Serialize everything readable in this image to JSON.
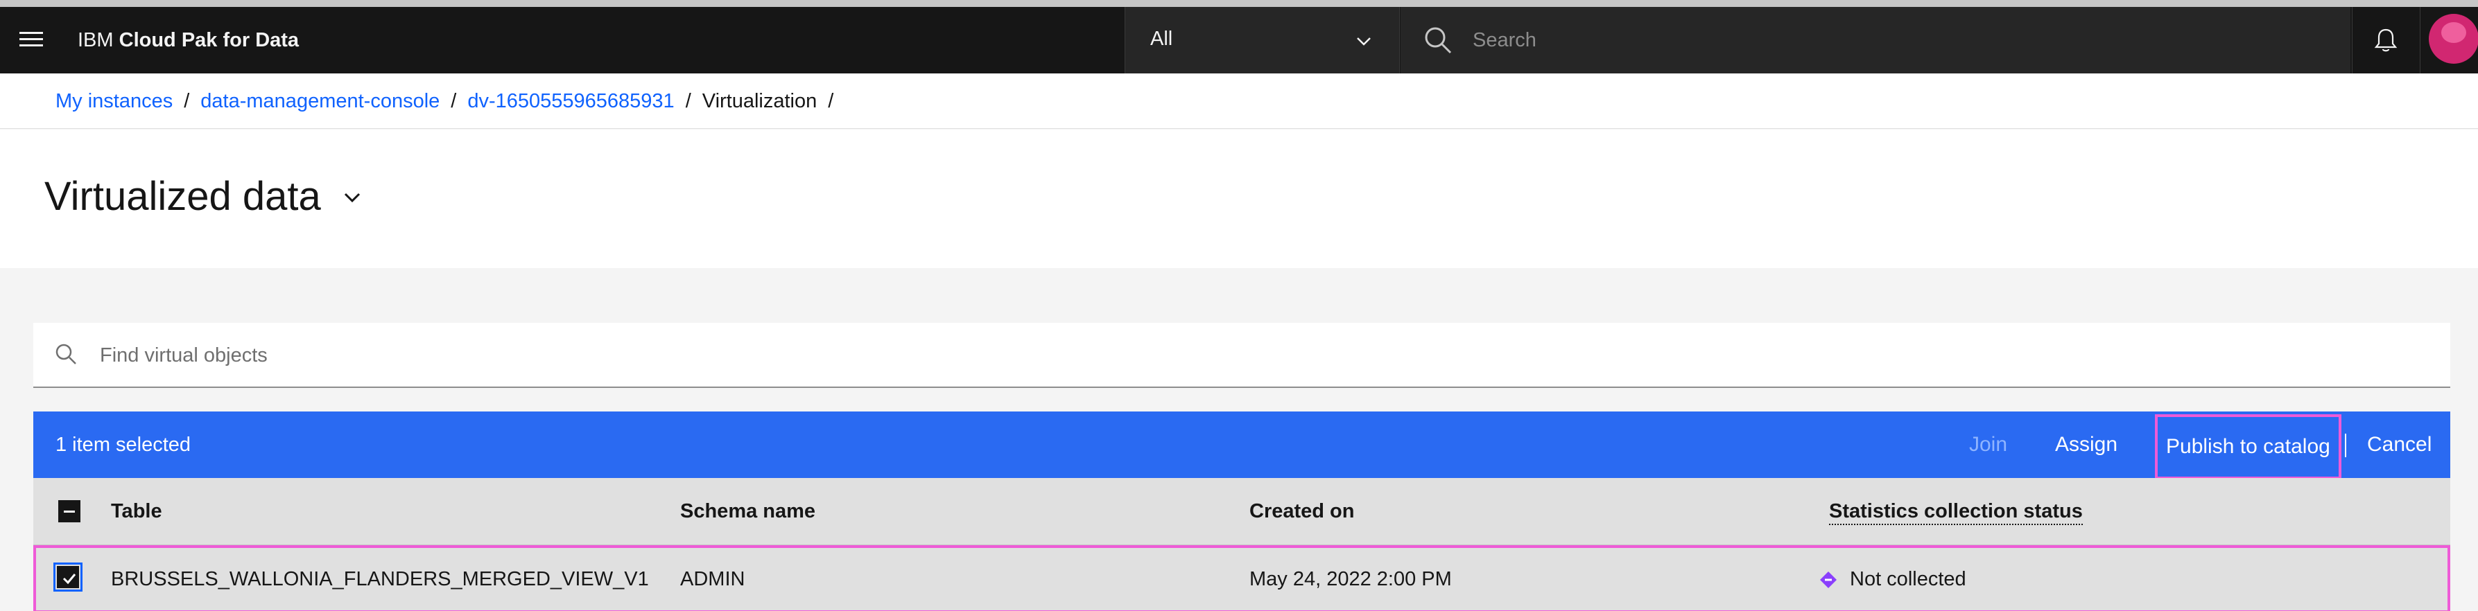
{
  "header": {
    "menu_icon": "hamburger-menu-icon",
    "brand_ibm": "IBM",
    "brand_product": "Cloud Pak for Data",
    "scope_value": "All",
    "search_placeholder": "Search",
    "notification_icon": "bell-icon",
    "avatar_icon": "user-avatar-icon"
  },
  "breadcrumb": {
    "items": [
      {
        "label": "My instances",
        "link": true
      },
      {
        "label": "data-management-console",
        "link": true
      },
      {
        "label": "dv-1650555965685931",
        "link": true
      },
      {
        "label": "Virtualization",
        "link": false
      }
    ],
    "separator": "/"
  },
  "page": {
    "title": "Virtualized data"
  },
  "find": {
    "placeholder": "Find virtual objects"
  },
  "batch_actions": {
    "selected_text": "1 item selected",
    "join_label": "Join",
    "assign_label": "Assign",
    "publish_label": "Publish to catalog",
    "cancel_label": "Cancel"
  },
  "table": {
    "columns": [
      "Table",
      "Schema name",
      "Created on",
      "Statistics collection status"
    ],
    "rows": [
      {
        "table": "BRUSSELS_WALLONIA_FLANDERS_MERGED_VIEW_V1",
        "schema": "ADMIN",
        "created_on": "May 24, 2022 2:00 PM",
        "status": "Not collected",
        "status_icon": "diamond-status-icon",
        "selected": true
      }
    ]
  },
  "colors": {
    "header_bg": "#161616",
    "link": "#0f62fe",
    "batch_bar": "#2a6af2",
    "highlight": "#ee5bd7",
    "status_icon": "#8a3ffc"
  }
}
